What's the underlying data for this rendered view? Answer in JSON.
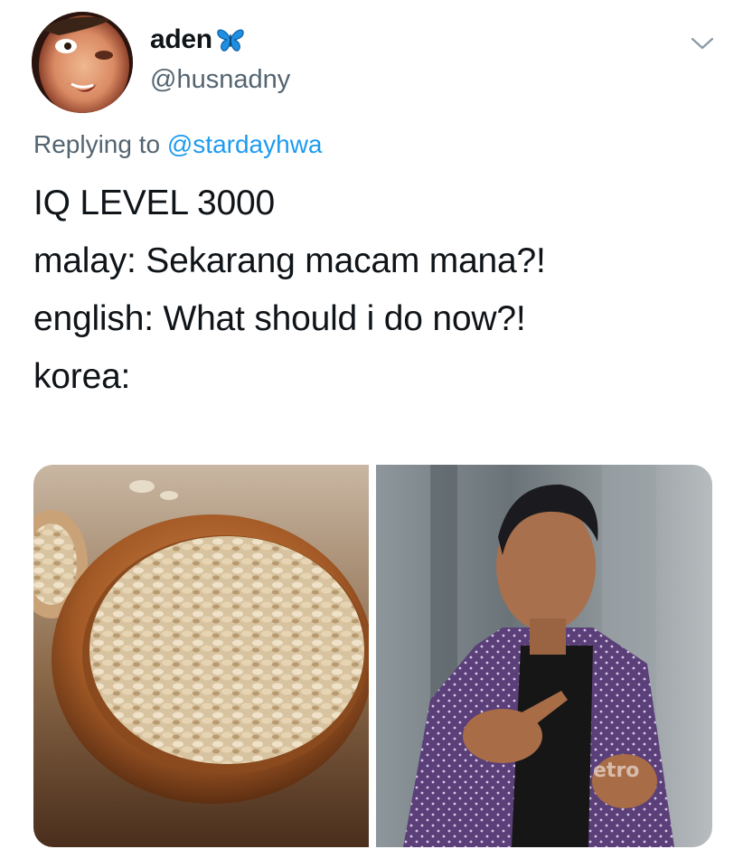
{
  "tweet": {
    "display_name": "aden",
    "name_emoji": "butterfly-icon",
    "handle": "@husnadny",
    "reply_prefix": "Replying to",
    "reply_mention": "@stardayhwa",
    "lines": [
      "IQ LEVEL 3000",
      "malay: Sekarang macam mana?!",
      "english: What should i do now?!",
      "korea:"
    ],
    "watermark": "etro"
  },
  "colors": {
    "text": "#0f1419",
    "secondary": "#536471",
    "link": "#1d9bf0",
    "butterfly": "#1f8fe0"
  },
  "media": {
    "left": "oats-in-wooden-bowl-photo",
    "right": "man-pointing-photo"
  }
}
